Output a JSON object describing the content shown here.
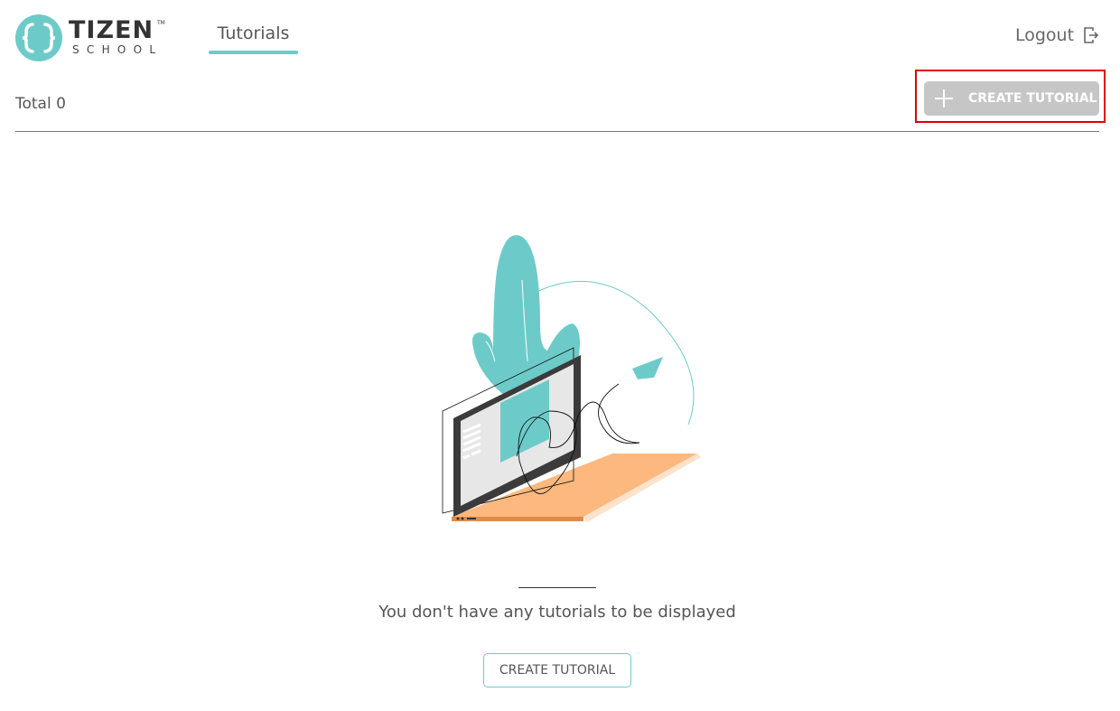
{
  "header": {
    "logo": {
      "title": "TIZEN",
      "subtitle": "SCHOOL",
      "tm": "TM"
    },
    "nav": {
      "tutorials_label": "Tutorials"
    },
    "logout": {
      "label": "Logout",
      "icon": "logout-icon"
    }
  },
  "toolbar": {
    "total_text": "Total 0",
    "create_button": {
      "label": "CREATE TUTORIAL",
      "icon": "plus-icon"
    }
  },
  "empty_state": {
    "message": "You don't have any tutorials to be displayed",
    "create_button_label": "CREATE TUTORIAL"
  },
  "colors": {
    "accent": "#6ccbc9",
    "button_disabled": "#c6c6c6",
    "highlight": "#e00000",
    "desk": "#fcb87e",
    "text": "#555555"
  }
}
